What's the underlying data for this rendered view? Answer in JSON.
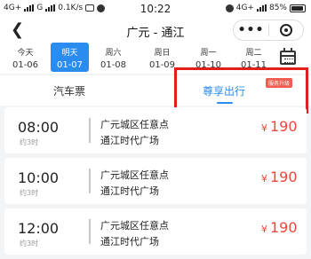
{
  "status_bar": {
    "network_left": "4G+",
    "network_mid": "G",
    "speed": "0.1K/s",
    "time": "10:22",
    "network_right": "4G+",
    "battery": "85%"
  },
  "nav": {
    "back_icon": "chevron-left-icon",
    "title": "广元 - 通江",
    "more_icon": "more-dots-icon",
    "close_icon": "target-icon"
  },
  "dates": [
    {
      "weekday": "今天",
      "date": "01-06",
      "active": false
    },
    {
      "weekday": "明天",
      "date": "01-07",
      "active": true
    },
    {
      "weekday": "周六",
      "date": "01-08",
      "active": false
    },
    {
      "weekday": "周日",
      "date": "01-09",
      "active": false
    },
    {
      "weekday": "周一",
      "date": "01-10",
      "active": false
    },
    {
      "weekday": "周二",
      "date": "01-11",
      "active": false
    }
  ],
  "tabs": {
    "bus_label": "汽车票",
    "premium_label": "尊享出行",
    "upgrade_badge": "服务升级"
  },
  "trips": [
    {
      "time": "08:00",
      "duration": "约3时",
      "from": "广元城区任意点",
      "to": "通江时代广场",
      "currency": "¥",
      "price": "190"
    },
    {
      "time": "10:00",
      "duration": "约3时",
      "from": "广元城区任意点",
      "to": "通江时代广场",
      "currency": "¥",
      "price": "190"
    },
    {
      "time": "12:00",
      "duration": "约3时",
      "from": "广元城区任意点",
      "to": "通江时代广场",
      "currency": "¥",
      "price": "190"
    }
  ],
  "colors": {
    "accent": "#2b8cf0",
    "price": "#f0453a",
    "highlight": "#e01e1e"
  }
}
